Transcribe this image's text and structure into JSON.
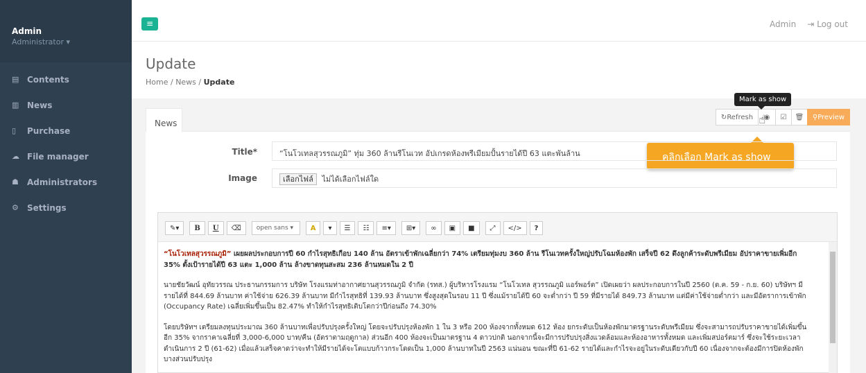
{
  "sidebar": {
    "user_name": "Admin",
    "user_role": "Administrator ▾",
    "items": [
      {
        "label": "Contents",
        "icon": "list-icon"
      },
      {
        "label": "News",
        "icon": "newspaper-icon"
      },
      {
        "label": "Purchase",
        "icon": "file-icon"
      },
      {
        "label": "File manager",
        "icon": "cloud-icon"
      },
      {
        "label": "Administrators",
        "icon": "users-icon"
      },
      {
        "label": "Settings",
        "icon": "cogs-icon"
      }
    ]
  },
  "topbar": {
    "menu_icon": "≡",
    "admin_label": "Admin",
    "logout_label": "Log out"
  },
  "heading": {
    "title": "Update",
    "breadcrumb": [
      "Home",
      "News",
      "Update"
    ]
  },
  "card": {
    "tab_label": "News",
    "toolbar": {
      "refresh_label": "Refresh",
      "preview_label": "Preview"
    },
    "tooltip": "Mark as show",
    "callout": "คลิกเลือก Mark as show"
  },
  "form": {
    "title_label": "Title*",
    "title_value": "“โนโวเทลสุวรรณภูมิ” ทุ่ม 360 ล้านรีโนเวท อัปเกรดห้องพรีเมียมปั้นรายได้ปี 63 แตะพันล้าน",
    "image_label": "Image",
    "file_button": "เลือกไฟล์",
    "file_status": "ไม่ได้เลือกไฟล์ใด"
  },
  "editor": {
    "font_select": "open sans ▾",
    "lead_red": "“โนโวเทลสุวรรณภูมิ”",
    "lead_rest": " เผยผลประกอบการปี 60 กำไรสุทธิเกือบ 140 ล้าน อัตราเข้าพักเฉลี่ยกว่า 74% เตรียมทุ่มงบ 360 ล้าน รีโนเวทครั้งใหญ่ปรับโฉมห้องพัก เสร็จปี 62 ดึงลูกค้าระดับพรีเมียม อัปราคาขายเพิ่มอีก 35% ตั้งเป้ารายได้ปี 63 แตะ 1,000 ล้าน ล้างขาดทุนสะสม 236 ล้านหมดใน 2 ปี",
    "para1": "นายชัยวัฒน์ อุทัยวรรณ ประธานกรรมการ บริษัท โรงแรมท่าอากาศยานสุวรรณภูมิ จำกัด (รทส.) ผู้บริหารโรงแรม “โนโวเทล สุวรรณภูมิ แอร์พอร์ต” เปิดเผยว่า ผลประกอบการในปี 2560 (ต.ค. 59 - ก.ย. 60) บริษัทฯ มีรายได้ที่ 844.69 ล้านบาท ค่าใช้จ่าย 626.39 ล้านบาท มีกำไรสุทธิที่ 139.93 ล้านบาท ซึ่งสูงสุดในรอบ 11 ปี ซึ่งแม้รายได้ปี 60 จะต่ำกว่า ปี 59 ที่มีรายได้ 849.73 ล้านบาท แต่มีค่าใช้จ่ายต่ำกว่า และมีอัตราการเข้าพัก (Occupancy Rate) เฉลี่ยเพิ่มขึ้นเป็น 82.47% ทำให้กำไรสุทธิเติบโตกว่าปีก่อนถึง 74.30%",
    "para2": "โดยบริษัทฯ เตรียมลงทุนประมาณ 360 ล้านบาทเพื่อปรับปรุงครั้งใหญ่ โดยจะปรับปรุงห้องพัก 1 ใน 3 หรือ 200 ห้องจากทั้งหมด 612 ห้อง ยกระดับเป็นห้องพักมาตรฐานระดับพรีเมียม ซึ่งจะสามารถปรับราคาขายได้เพิ่มขึ้นอีก 35% จากราคาเฉลี่ยที่ 3,000-6,000 บาท/คืน (อัตราตามฤดูกาล) ส่วนอีก 400 ห้องจะเป็นมาตรฐาน 4 ดาวปกติ นอกจากนี้จะมีการปรับปรุงสิ่งแวดล้อมและห้องอาหารทั้งหมด และเพิ่มสปอร์ตมาร์ ซึ่งจะใช้ระยะเวลาดำเนินการ 2 ปี (61-62) เมื่อแล้วเสร็จคาดว่าจะทำให้มีรายได้จะโตแบบก้าวกระโดดเป็น 1,000 ล้านบาทในปี 2563 แน่นอน ขณะที่ปี 61-62 รายได้และกำไรจะอยู่ในระดับเดียวกับปี 60 เนื่องจากจะต้องมีการปิดห้องพักบางส่วนปรับปรุง"
  },
  "colors": {
    "sidebar_bg": "#2f4050",
    "accent_green": "#1ab394",
    "preview_orange": "#f8ac59",
    "callout_orange": "#f5a623",
    "lead_red": "#a61c00"
  }
}
